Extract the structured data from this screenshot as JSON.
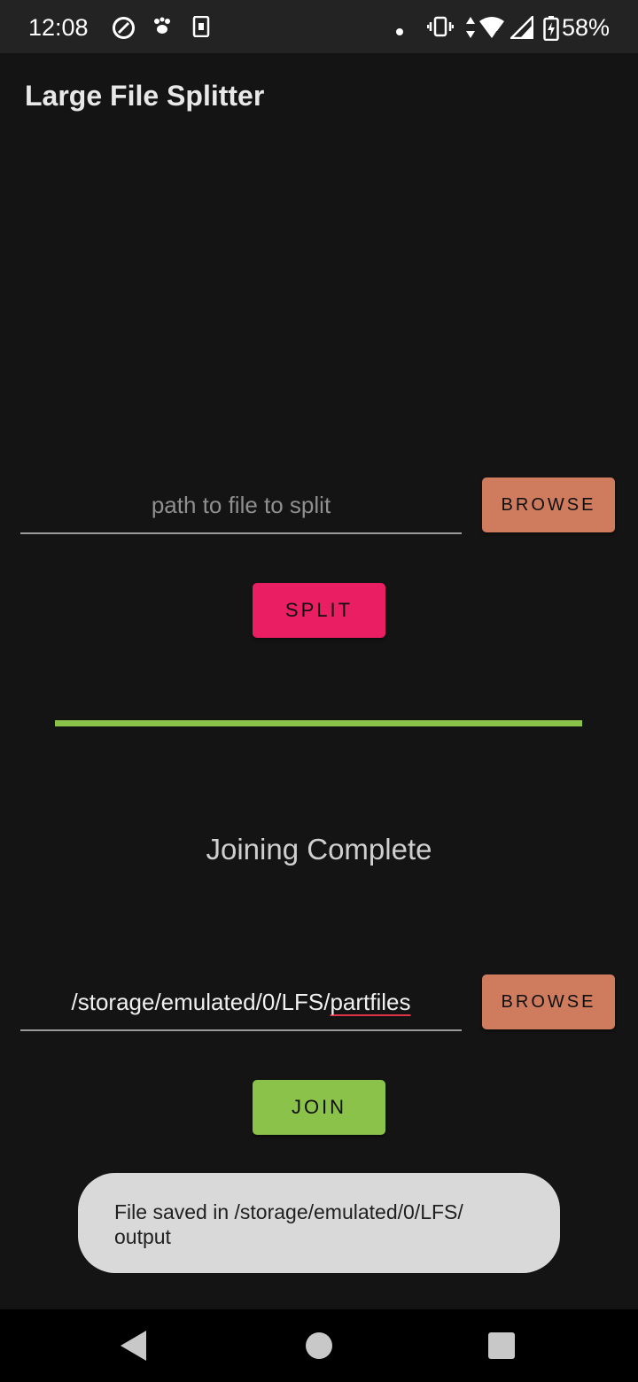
{
  "status_bar": {
    "time": "12:08",
    "battery_percent": "58%",
    "icons": [
      "sync-icon",
      "paw-icon",
      "sim-card-icon",
      "dot-icon",
      "vibrate-icon",
      "data-arrows-icon",
      "wifi-icon",
      "signal-icon",
      "battery-charging-icon"
    ]
  },
  "app": {
    "title": "Large File Splitter"
  },
  "split_section": {
    "input_placeholder": "path to file to split",
    "browse_label": "BROWSE",
    "split_label": "SPLIT"
  },
  "progress": {
    "percent": 100,
    "color": "#8bc34a"
  },
  "join_section": {
    "status": "Joining Complete",
    "input_value_prefix": "/storage/emulated/0/LFS/",
    "input_value_suffix": "partfiles",
    "browse_label": "BROWSE",
    "join_label": "JOIN"
  },
  "toast": {
    "line1": "File saved in /storage/emulated/0/LFS/",
    "line2": "output"
  },
  "colors": {
    "browse": "#cf7b5e",
    "split": "#e91e63",
    "join": "#8bc34a"
  }
}
